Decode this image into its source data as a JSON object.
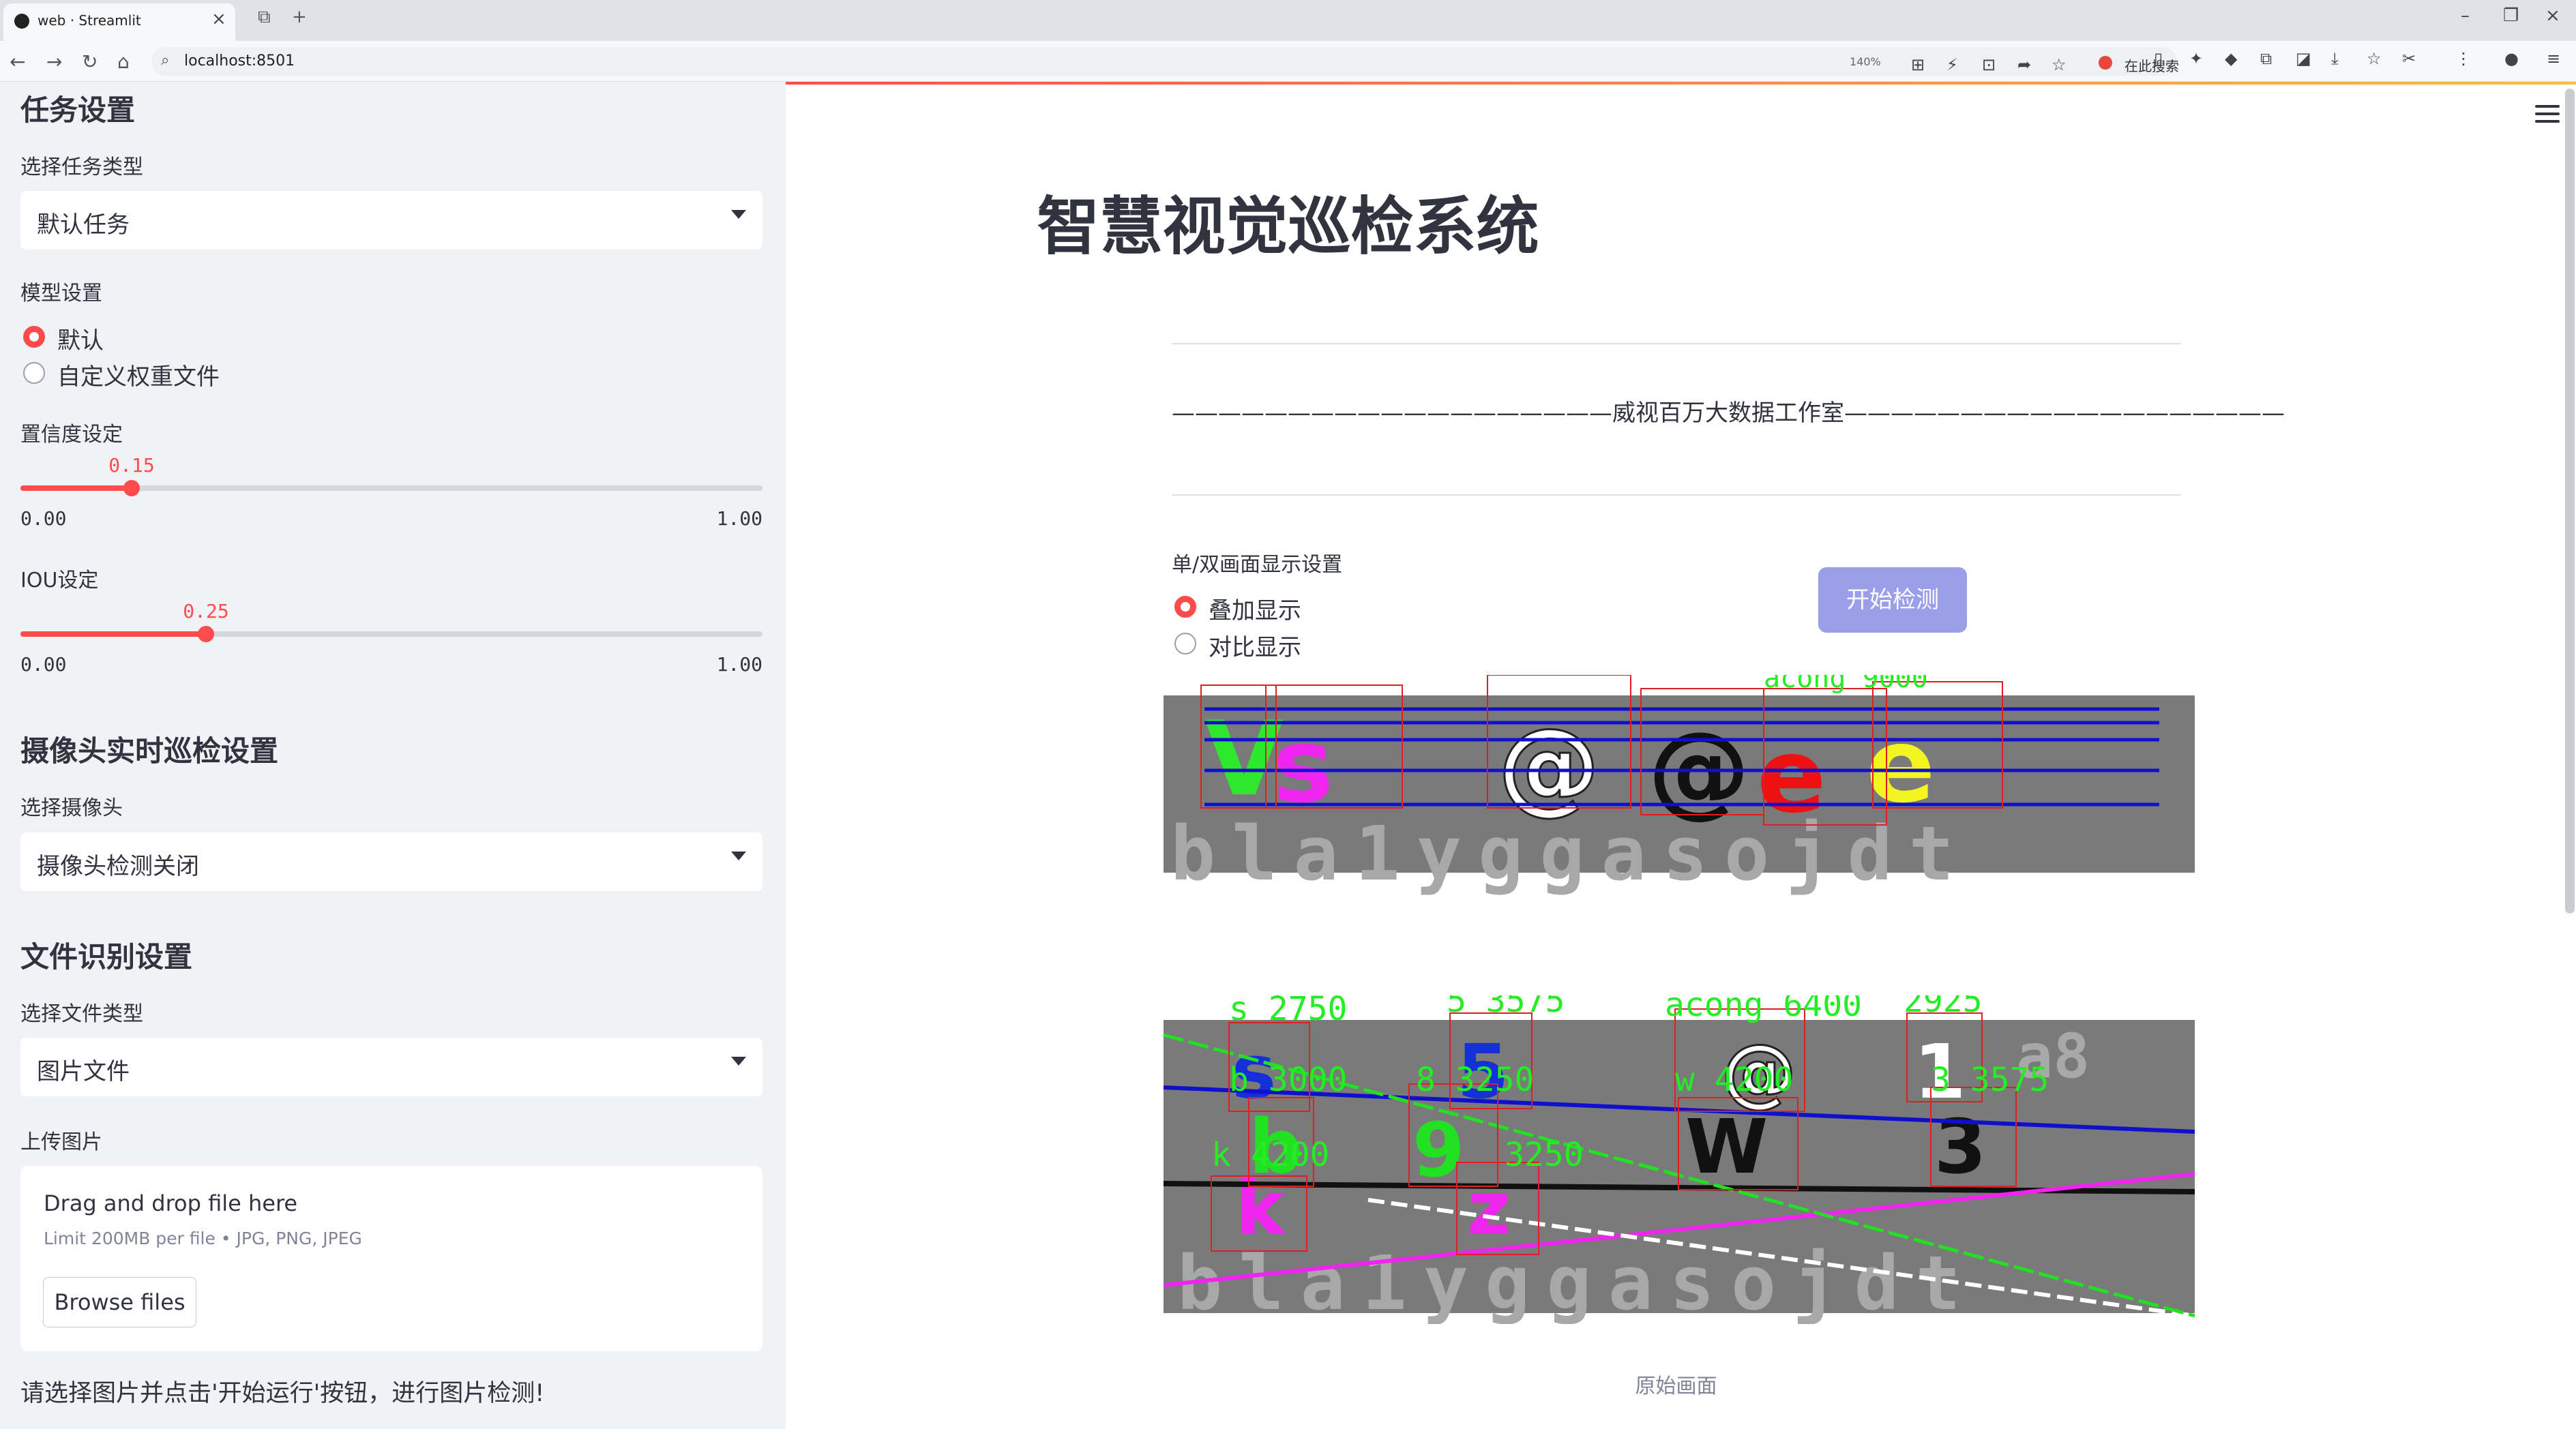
{
  "browser": {
    "tab_title": "web · Streamlit",
    "url": "localhost:8501",
    "zoom": "140%",
    "search_placeholder": "在此搜索"
  },
  "sidebar": {
    "task_section_title": "任务设置",
    "task_type_label": "选择任务类型",
    "task_type_value": "默认任务",
    "model_label": "模型设置",
    "model_options": [
      "默认",
      "自定义权重文件"
    ],
    "model_selected": "默认",
    "conf_label": "置信度设定",
    "conf_value": "0.15",
    "conf_min": "0.00",
    "conf_max": "1.00",
    "iou_label": "IOU设定",
    "iou_value": "0.25",
    "iou_min": "0.00",
    "iou_max": "1.00",
    "camera_section_title": "摄像头实时巡检设置",
    "camera_label": "选择摄像头",
    "camera_value": "摄像头检测关闭",
    "file_section_title": "文件识别设置",
    "file_type_label": "选择文件类型",
    "file_type_value": "图片文件",
    "upload_label": "上传图片",
    "upload_title": "Drag and drop file here",
    "upload_limit": "Limit 200MB per file • JPG, PNG, JPEG",
    "browse_label": "Browse files",
    "hint": "请选择图片并点击'开始运行'按钮，进行图片检测!"
  },
  "main": {
    "title": "智慧视觉巡检系统",
    "studio_line": "———————————————————威视百万大数据工作室———————————————————",
    "display_label": "单/双画面显示设置",
    "display_options": [
      "叠加显示",
      "对比显示"
    ],
    "display_selected": "叠加显示",
    "start_button": "开始检测",
    "caption": "原始画面",
    "detections_top": [
      "acong 9000"
    ],
    "detections_bottom": [
      "s 2750",
      "5 3575",
      "acong 6400",
      "2925",
      "b 3000",
      "8 3250",
      "w 4200",
      "3 3575",
      "k 4200",
      "3250"
    ]
  },
  "colors": {
    "accent": "#ff4b4b",
    "sidebar_bg": "#f0f2f6",
    "button": "#9b9fe9"
  }
}
